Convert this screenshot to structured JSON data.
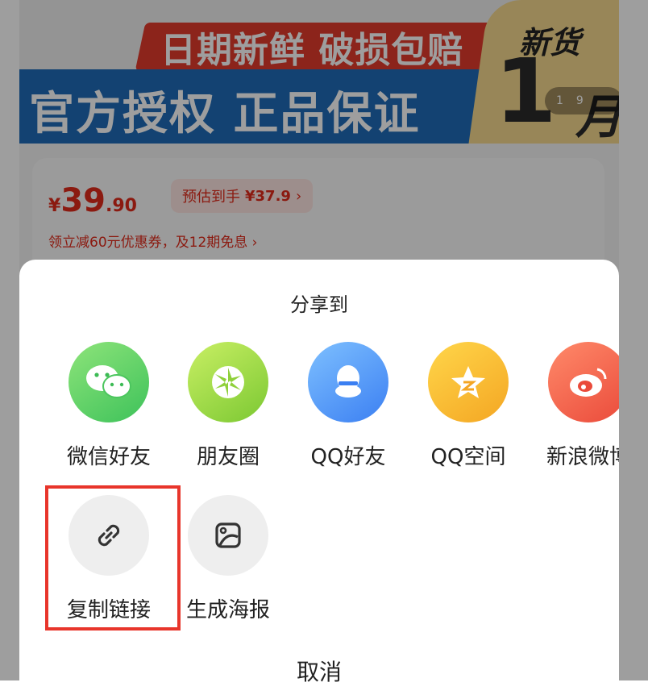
{
  "banner": {
    "top_text": "日期新鲜 破损包赔",
    "main_text": "官方授权 正品保证",
    "badge_label": "新货",
    "badge_number": "1",
    "badge_unit": "月",
    "pager_current": "1",
    "pager_total": "9"
  },
  "price": {
    "currency": "¥",
    "integer": "39",
    "decimal": ".90",
    "estimate_label": "预估到手",
    "estimate_value": "¥37.9",
    "coupon_text": "领立减60元优惠券，及12期免息 ›"
  },
  "share_sheet": {
    "title": "分享到",
    "items": [
      {
        "label": "微信好友",
        "icon": "wechat-icon"
      },
      {
        "label": "朋友圈",
        "icon": "moments-icon"
      },
      {
        "label": "QQ好友",
        "icon": "qq-icon"
      },
      {
        "label": "QQ空间",
        "icon": "qzone-icon"
      },
      {
        "label": "新浪微博",
        "icon": "weibo-icon"
      }
    ],
    "tools": [
      {
        "label": "复制链接",
        "icon": "link-icon"
      },
      {
        "label": "生成海报",
        "icon": "poster-icon"
      }
    ],
    "cancel_label": "取消"
  },
  "colors": {
    "price_red": "#e02a1b",
    "highlight_red": "#e8352b",
    "banner_blue": "#1f6bb8"
  }
}
